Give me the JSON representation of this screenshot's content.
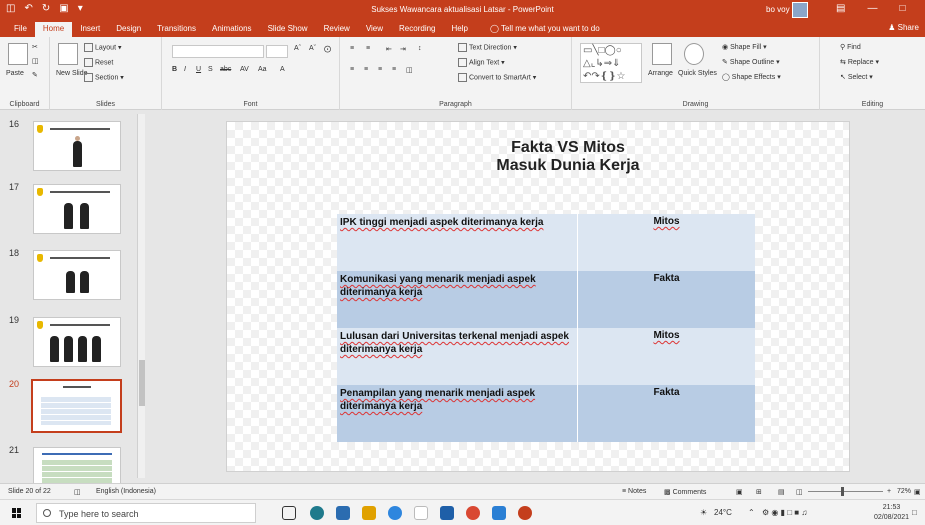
{
  "window": {
    "title": "Sukses Wawancara aktualisasi Latsar - PowerPoint",
    "user": "bo voy"
  },
  "tabs": [
    {
      "label": "File"
    },
    {
      "label": "Home",
      "active": true
    },
    {
      "label": "Insert"
    },
    {
      "label": "Design"
    },
    {
      "label": "Transitions"
    },
    {
      "label": "Animations"
    },
    {
      "label": "Slide Show"
    },
    {
      "label": "Review"
    },
    {
      "label": "View"
    },
    {
      "label": "Recording"
    },
    {
      "label": "Help"
    }
  ],
  "tellme": "Tell me what you want to do",
  "share": "Share",
  "ribbon": {
    "clipboard": {
      "label": "Clipboard",
      "paste": "Paste"
    },
    "slides": {
      "label": "Slides",
      "new_slide": "New Slide",
      "layout": "Layout",
      "reset": "Reset",
      "section": "Section"
    },
    "font": {
      "label": "Font"
    },
    "paragraph": {
      "label": "Paragraph",
      "text_direction": "Text Direction",
      "align_text": "Align Text",
      "convert": "Convert to SmartArt"
    },
    "drawing": {
      "label": "Drawing",
      "arrange": "Arrange",
      "quick_styles": "Quick Styles",
      "shape_fill": "Shape Fill",
      "shape_outline": "Shape Outline",
      "shape_effects": "Shape Effects"
    },
    "editing": {
      "label": "Editing",
      "find": "Find",
      "replace": "Replace",
      "select": "Select"
    }
  },
  "thumbnails": [
    {
      "num": "16",
      "title": "Baju Kerja Laki-laki"
    },
    {
      "num": "17",
      "title": "Celana Kerja"
    },
    {
      "num": "18",
      "title": "Baju Wanita"
    },
    {
      "num": "19",
      "title": "Baju Kerja"
    },
    {
      "num": "20",
      "title": "Fakta VS Mitos",
      "selected": true
    },
    {
      "num": "21",
      "title": ""
    }
  ],
  "slide": {
    "title_line1": "Fakta VS Mitos",
    "title_line2": "Masuk Dunia Kerja",
    "rows": [
      {
        "statement": "IPK tinggi menjadi aspek diterimanya kerja",
        "verdict": "Mitos"
      },
      {
        "statement": "Komunikasi yang menarik menjadi aspek diterimanya kerja",
        "verdict": "Fakta"
      },
      {
        "statement": "Lulusan dari Universitas terkenal menjadi aspek diterimanya kerja",
        "verdict": "Mitos"
      },
      {
        "statement": "Penampilan yang menarik menjadi aspek diterimanya kerja",
        "verdict": "Fakta"
      }
    ]
  },
  "status": {
    "slide_info": "Slide 20 of 22",
    "language": "English (Indonesia)",
    "notes": "Notes",
    "comments": "Comments",
    "zoom": "72%"
  },
  "taskbar": {
    "search_placeholder": "Type here to search",
    "weather": "24°C",
    "time": "21:53",
    "date": "02/08/2021"
  },
  "colors": {
    "accent": "#c43e1c",
    "row_light": "#dce6f2",
    "row_dark": "#b8cce4"
  }
}
